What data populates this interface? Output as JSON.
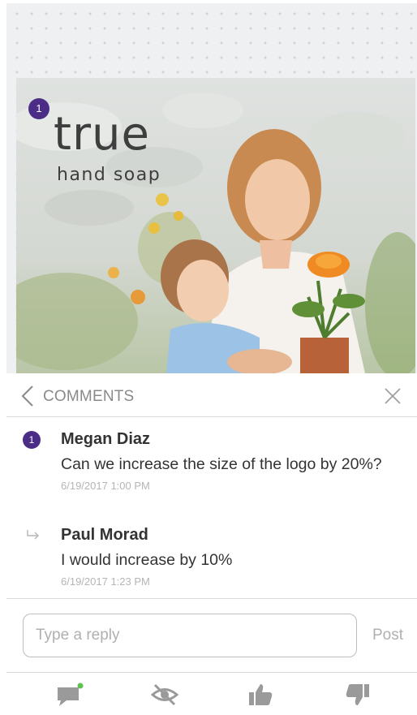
{
  "preview": {
    "marker_number": "1",
    "brand_word": "true",
    "brand_sub": "hand soap"
  },
  "comments_panel": {
    "title": "COMMENTS",
    "comments": [
      {
        "badge": "1",
        "author": "Megan Diaz",
        "text": "Can we increase the size of the logo by 20%?",
        "time": "6/19/2017 1:00 PM"
      },
      {
        "badge": "reply-icon",
        "author": "Paul Morad",
        "text": "I would increase by 10%",
        "time": "6/19/2017 1:23 PM"
      }
    ]
  },
  "reply": {
    "placeholder": "Type a reply",
    "value": "",
    "post_label": "Post"
  },
  "toolbar": {
    "items": [
      "comment-icon",
      "hide-icon",
      "thumbs-up-icon",
      "thumbs-down-icon"
    ],
    "comment_active_dot_color": "#5cc14e"
  },
  "colors": {
    "accent": "#4b2d87",
    "icon_gray": "#9a9a9a"
  }
}
